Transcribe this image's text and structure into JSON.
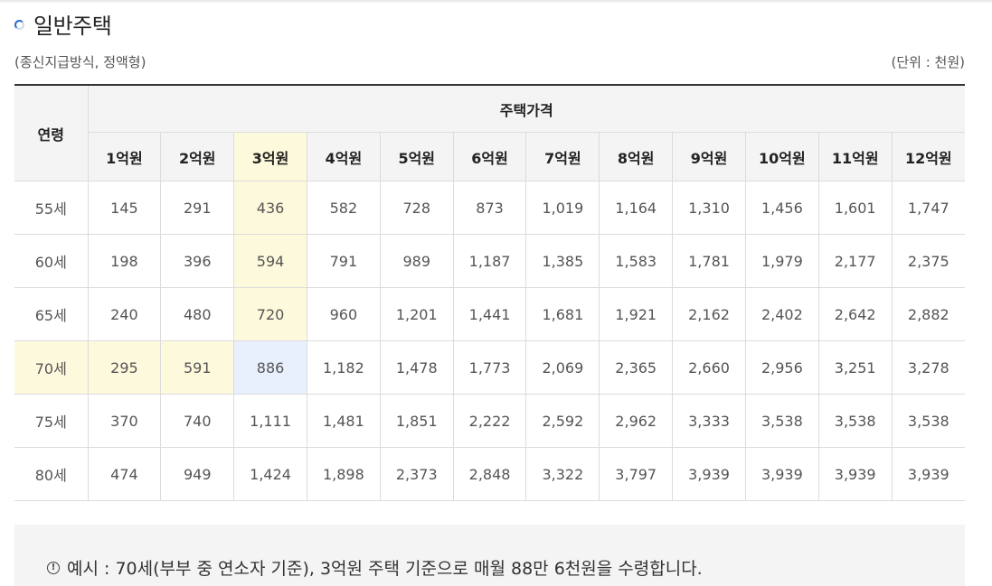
{
  "section": {
    "title": "일반주택",
    "method_note": "(종신지급방식, 정액형)",
    "unit_note": "(단위 : 천원)"
  },
  "table": {
    "age_header": "연령",
    "price_header": "주택가격",
    "prices": [
      "1억원",
      "2억원",
      "3억원",
      "4억원",
      "5억원",
      "6억원",
      "7억원",
      "8억원",
      "9억원",
      "10억원",
      "11억원",
      "12억원"
    ],
    "rows": [
      {
        "age": "55세",
        "values": [
          "145",
          "291",
          "436",
          "582",
          "728",
          "873",
          "1,019",
          "1,164",
          "1,310",
          "1,456",
          "1,601",
          "1,747"
        ]
      },
      {
        "age": "60세",
        "values": [
          "198",
          "396",
          "594",
          "791",
          "989",
          "1,187",
          "1,385",
          "1,583",
          "1,781",
          "1,979",
          "2,177",
          "2,375"
        ]
      },
      {
        "age": "65세",
        "values": [
          "240",
          "480",
          "720",
          "960",
          "1,201",
          "1,441",
          "1,681",
          "1,921",
          "2,162",
          "2,402",
          "2,642",
          "2,882"
        ]
      },
      {
        "age": "70세",
        "values": [
          "295",
          "591",
          "886",
          "1,182",
          "1,478",
          "1,773",
          "2,069",
          "2,365",
          "2,660",
          "2,956",
          "3,251",
          "3,278"
        ]
      },
      {
        "age": "75세",
        "values": [
          "370",
          "740",
          "1,111",
          "1,481",
          "1,851",
          "2,222",
          "2,592",
          "2,962",
          "3,333",
          "3,538",
          "3,538",
          "3,538"
        ]
      },
      {
        "age": "80세",
        "values": [
          "474",
          "949",
          "1,424",
          "1,898",
          "2,373",
          "2,848",
          "3,322",
          "3,797",
          "3,939",
          "3,939",
          "3,939",
          "3,939"
        ]
      }
    ],
    "highlight_column_index": 2,
    "highlight_row_index": 3,
    "colors": {
      "highlight_yellow": "#fdf9dc",
      "highlight_blue": "#e8f0fd",
      "header_bg": "#f4f4f4"
    }
  },
  "example": {
    "icon": "info-circle-icon",
    "text": "예시 : 70세(부부 중 연소자 기준), 3억원 주택 기준으로 매월 88만 6천원을 수령합니다."
  }
}
